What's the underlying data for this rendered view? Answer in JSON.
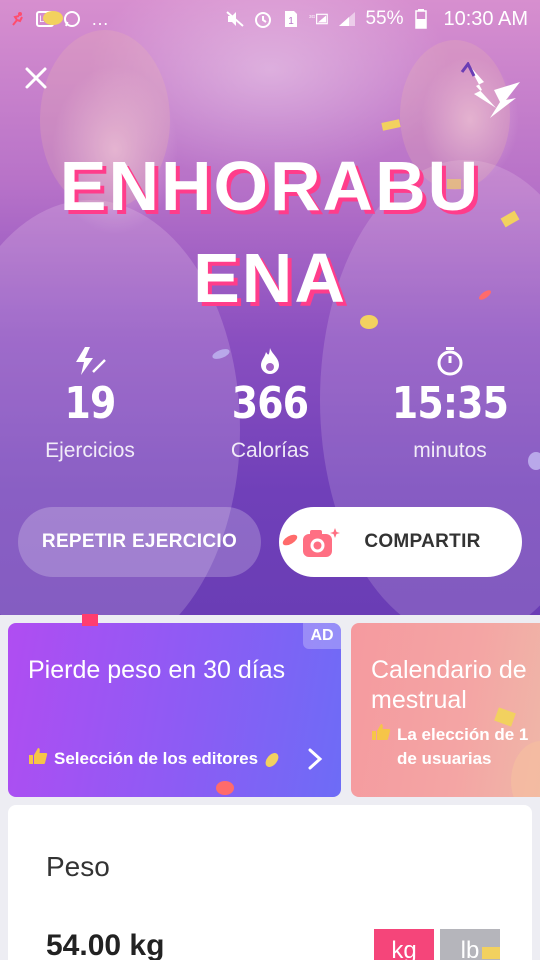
{
  "status_bar": {
    "battery": "55%",
    "time": "10:30 AM",
    "network": "3G"
  },
  "hero": {
    "title_line1": "ENHORABU",
    "title_line2": "ENA",
    "stats": [
      {
        "icon": "lightning-icon",
        "value": "19",
        "label": "Ejercicios"
      },
      {
        "icon": "flame-icon",
        "value": "366",
        "label": "Calorías"
      },
      {
        "icon": "stopwatch-icon",
        "value": "15:35",
        "label": "minutos"
      }
    ],
    "repeat_button": "REPETIR EJERCICIO",
    "share_button": "COMPARTIR"
  },
  "cards": [
    {
      "title": "Pierde peso en 30 días",
      "subtitle": "Selección de los editores",
      "badge": "AD"
    },
    {
      "title": "Calendario de\nmestrual",
      "subtitle": "La elección de 1\nde usuarias"
    }
  ],
  "weight": {
    "title": "Peso",
    "value": "54.00 kg",
    "unit_kg": "kg",
    "unit_lb": "lb"
  },
  "colors": {
    "accent": "#ff3d8b",
    "hero_purple": "#7040b9",
    "kg_active": "#f5457a"
  }
}
